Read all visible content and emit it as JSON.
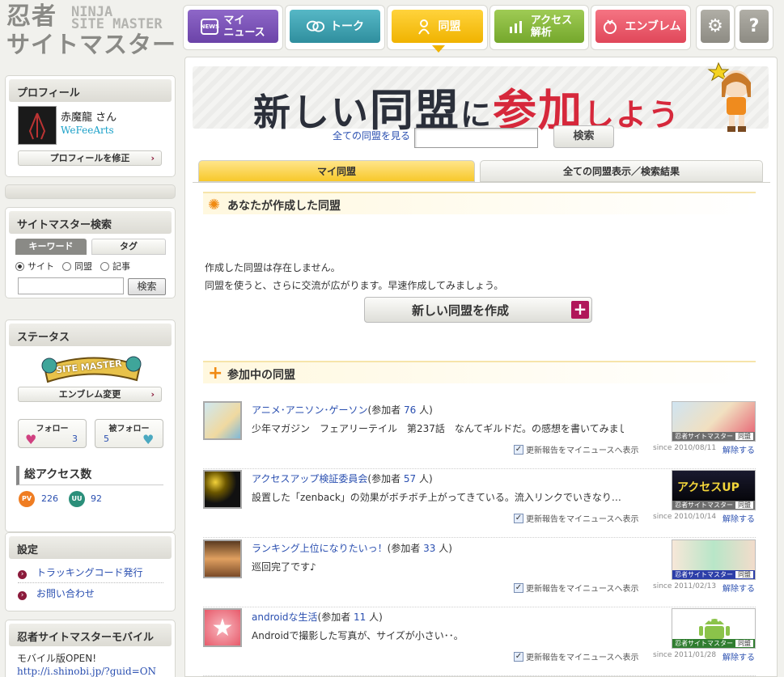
{
  "logo": {
    "main_line1": "忍者",
    "main_line2": "サイトマスター",
    "sub_line1": "NINJA",
    "sub_line2": "SITE MASTER"
  },
  "nav": [
    {
      "label": "マイ\nニュース",
      "label1": "マイ",
      "label2": "ニュース",
      "icon_text": "NEWS",
      "color": "#7b52b8"
    },
    {
      "label": "トーク",
      "color": "#3d9fae"
    },
    {
      "label": "同盟",
      "color": "#f3bd0f"
    },
    {
      "label1": "アクセス",
      "label2": "解析",
      "color": "#86b83a"
    },
    {
      "label": "エンブレム",
      "color": "#e9596b"
    }
  ],
  "nav_icons": {
    "settings": "⚙",
    "help": "?"
  },
  "profile": {
    "header": "プロフィール",
    "name": "赤魔龍 さん",
    "link": "WeFeeArts",
    "edit_button": "プロフィールを修正"
  },
  "search": {
    "header": "サイトマスター検索",
    "tab_keyword": "キーワード",
    "tab_tag": "タグ",
    "radio_site": "サイト",
    "radio_alliance": "同盟",
    "radio_article": "記事",
    "button": "検索",
    "input_value": ""
  },
  "status": {
    "header": "ステータス",
    "emblem_text": "SITE MASTER",
    "emblem_button": "エンブレム変更",
    "follow_label": "フォロー",
    "follow_count": "3",
    "followed_label": "被フォロー",
    "followed_count": "5",
    "access_header": "総アクセス数",
    "pv_label": "PV",
    "pv_value": "226",
    "uu_label": "UU",
    "uu_value": "92"
  },
  "settings": {
    "header": "設定",
    "link1": "トラッキングコード発行",
    "link2": "お問い合わせ"
  },
  "mobile": {
    "header": "忍者サイトマスターモバイル",
    "text": "モバイル版OPEN!",
    "url": "http://i.shinobi.jp/?guid=ON"
  },
  "main": {
    "hero_a": "新しい",
    "hero_b": "同盟",
    "hero_c": "に",
    "hero_d": "参加",
    "hero_e": "しよう",
    "view_all_link": "全ての同盟を見る",
    "search_value": "",
    "search_button": "検索",
    "tab_my": "マイ同盟",
    "tab_all": "全ての同盟表示／検索結果",
    "created_header": "あなたが作成した同盟",
    "none_text1": "作成した同盟は存在しません。",
    "none_text2": "同盟を使うと、さらに交流が広がります。早速作成してみましょう。",
    "create_button": "新しい同盟を作成",
    "joined_header": "参加中の同盟"
  },
  "alliances": [
    {
      "name": "アニメ･アニソン･ゲーソン",
      "member_prefix": "(参加者 ",
      "members": "76",
      "member_suffix": " 人)",
      "desc": "少年マガジン　フェアリーテイル　第237話　なんてギルドだ。の感想を書いてみまし…",
      "update": "更新報告をマイニュースへ表示",
      "since": "since 2010/08/11",
      "leave": "解除する",
      "banner_foot": "忍者サイトマスター",
      "banner_tag": "同盟",
      "banner_text": ""
    },
    {
      "name": "アクセスアップ検証委員会",
      "member_prefix": "(参加者 ",
      "members": "57",
      "member_suffix": " 人)",
      "desc": "設置した「zenback」の効果がボチボチ上がってきている。流入リンクでいきなり…",
      "update": "更新報告をマイニュースへ表示",
      "since": "since 2010/10/14",
      "leave": "解除する",
      "banner_foot": "忍者サイトマスター",
      "banner_tag": "同盟",
      "banner_text": "アクセスUP"
    },
    {
      "name": "ランキング上位になりたいっ！",
      "member_prefix": "(参加者 ",
      "members": "33",
      "member_suffix": " 人)",
      "desc": "巡回完了です♪",
      "update": "更新報告をマイニュースへ表示",
      "since": "since 2011/02/13",
      "leave": "解除する",
      "banner_foot": "忍者サイトマスター",
      "banner_tag": "同盟",
      "banner_text": ""
    },
    {
      "name": "androidな生活",
      "member_prefix": "(参加者 ",
      "members": "11",
      "member_suffix": " 人)",
      "desc": "Androidで撮影した写真が、サイズが小さい･･。",
      "update": "更新報告をマイニュースへ表示",
      "since": "since 2011/01/28",
      "leave": "解除する",
      "banner_foot": "忍者サイトマスター",
      "banner_tag": "同盟",
      "banner_text": ""
    }
  ]
}
